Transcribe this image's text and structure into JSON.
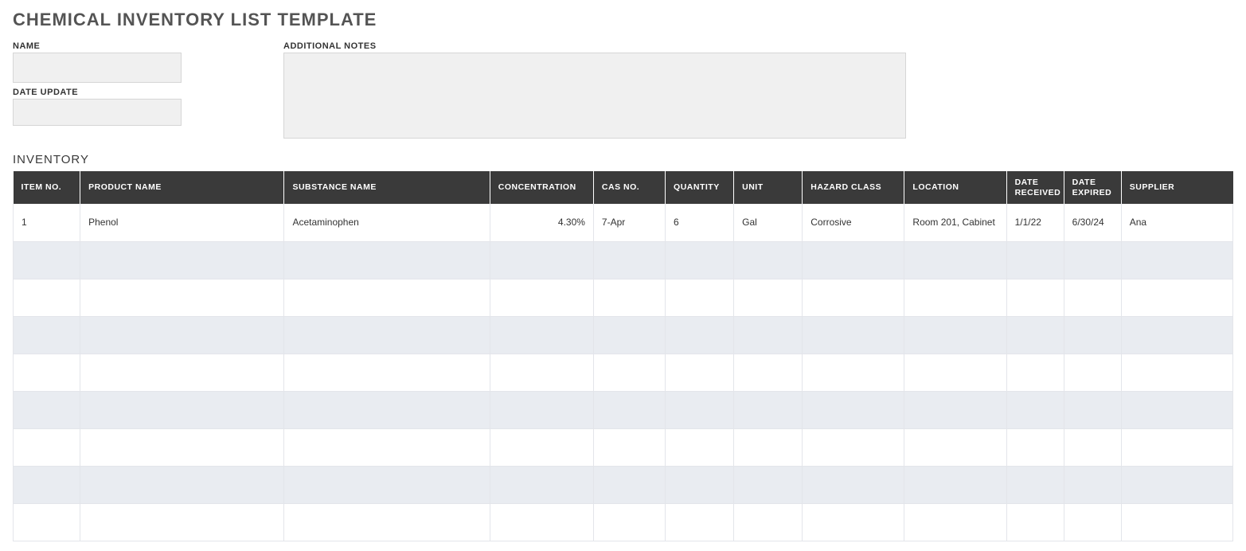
{
  "title": "CHEMICAL INVENTORY LIST TEMPLATE",
  "form": {
    "name_label": "NAME",
    "name_value": "",
    "date_update_label": "DATE UPDATE",
    "date_update_value": "",
    "notes_label": "ADDITIONAL NOTES",
    "notes_value": ""
  },
  "section_title": "INVENTORY",
  "columns": {
    "item_no": "ITEM NO.",
    "product_name": "PRODUCT NAME",
    "substance_name": "SUBSTANCE NAME",
    "concentration": "CONCENTRATION",
    "cas_no": "CAS NO.",
    "quantity": "QUANTITY",
    "unit": "UNIT",
    "hazard_class": "HAZARD CLASS",
    "location": "LOCATION",
    "date_received": "DATE RECEIVED",
    "date_expired": "DATE EXPIRED",
    "supplier": "SUPPLIER"
  },
  "rows": [
    {
      "item_no": "1",
      "product_name": "Phenol",
      "substance_name": "Acetaminophen",
      "concentration": "4.30%",
      "cas_no": "7-Apr",
      "quantity": "6",
      "unit": "Gal",
      "hazard_class": "Corrosive",
      "location": "Room 201, Cabinet",
      "date_received": "1/1/22",
      "date_expired": "6/30/24",
      "supplier": "Ana"
    },
    {
      "item_no": "",
      "product_name": "",
      "substance_name": "",
      "concentration": "",
      "cas_no": "",
      "quantity": "",
      "unit": "",
      "hazard_class": "",
      "location": "",
      "date_received": "",
      "date_expired": "",
      "supplier": ""
    },
    {
      "item_no": "",
      "product_name": "",
      "substance_name": "",
      "concentration": "",
      "cas_no": "",
      "quantity": "",
      "unit": "",
      "hazard_class": "",
      "location": "",
      "date_received": "",
      "date_expired": "",
      "supplier": ""
    },
    {
      "item_no": "",
      "product_name": "",
      "substance_name": "",
      "concentration": "",
      "cas_no": "",
      "quantity": "",
      "unit": "",
      "hazard_class": "",
      "location": "",
      "date_received": "",
      "date_expired": "",
      "supplier": ""
    },
    {
      "item_no": "",
      "product_name": "",
      "substance_name": "",
      "concentration": "",
      "cas_no": "",
      "quantity": "",
      "unit": "",
      "hazard_class": "",
      "location": "",
      "date_received": "",
      "date_expired": "",
      "supplier": ""
    },
    {
      "item_no": "",
      "product_name": "",
      "substance_name": "",
      "concentration": "",
      "cas_no": "",
      "quantity": "",
      "unit": "",
      "hazard_class": "",
      "location": "",
      "date_received": "",
      "date_expired": "",
      "supplier": ""
    },
    {
      "item_no": "",
      "product_name": "",
      "substance_name": "",
      "concentration": "",
      "cas_no": "",
      "quantity": "",
      "unit": "",
      "hazard_class": "",
      "location": "",
      "date_received": "",
      "date_expired": "",
      "supplier": ""
    },
    {
      "item_no": "",
      "product_name": "",
      "substance_name": "",
      "concentration": "",
      "cas_no": "",
      "quantity": "",
      "unit": "",
      "hazard_class": "",
      "location": "",
      "date_received": "",
      "date_expired": "",
      "supplier": ""
    },
    {
      "item_no": "",
      "product_name": "",
      "substance_name": "",
      "concentration": "",
      "cas_no": "",
      "quantity": "",
      "unit": "",
      "hazard_class": "",
      "location": "",
      "date_received": "",
      "date_expired": "",
      "supplier": ""
    }
  ]
}
